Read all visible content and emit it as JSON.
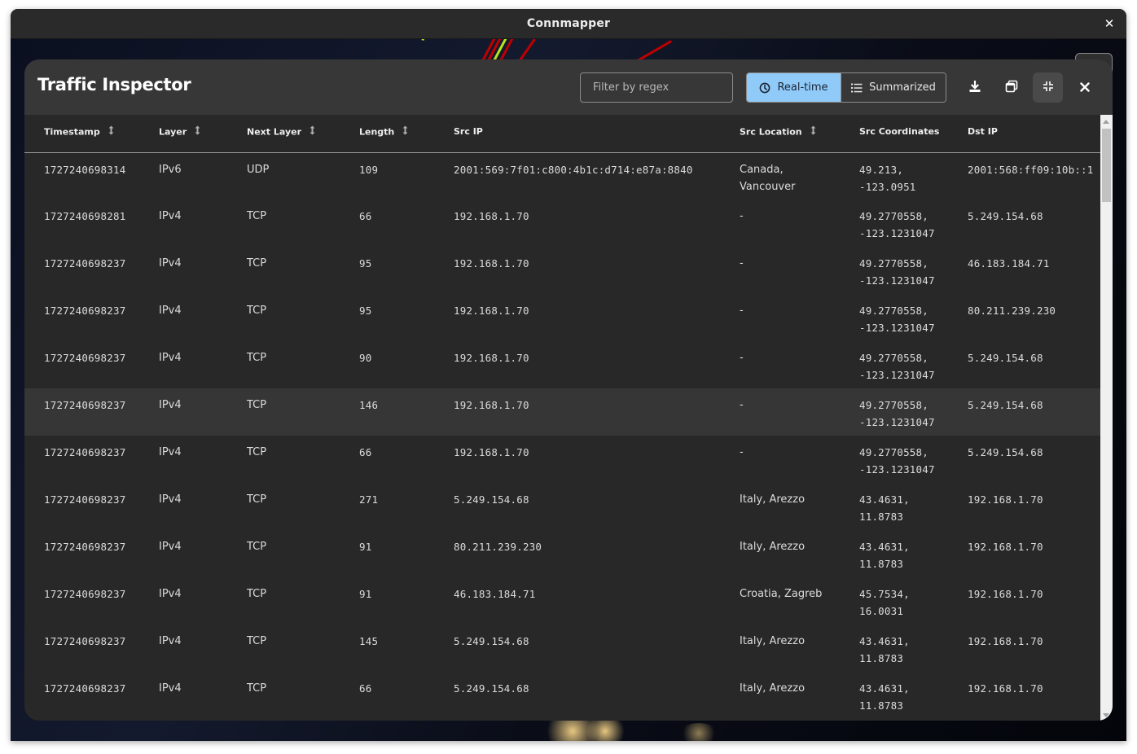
{
  "window": {
    "title": "Connmapper",
    "close_icon": "close-icon"
  },
  "dialog": {
    "title": "Traffic Inspector",
    "filter": {
      "placeholder": "Filter by regex",
      "value": ""
    },
    "view_toggle": {
      "options": [
        {
          "label": "Real-time",
          "icon": "clock-icon",
          "active": true
        },
        {
          "label": "Summarized",
          "icon": "list-icon",
          "active": false
        }
      ]
    },
    "actions": [
      {
        "name": "download",
        "icon": "download-icon"
      },
      {
        "name": "detach-window",
        "icon": "window-restore-icon"
      },
      {
        "name": "exit-fullscreen",
        "icon": "collapse-icon",
        "active": true
      },
      {
        "name": "close",
        "icon": "close-icon"
      }
    ]
  },
  "colors": {
    "accent": "#90caf9",
    "dialog_bg": "#282828",
    "header_bg": "#373737",
    "row_highlight": "#363636",
    "map_line_green": "#b5e61d",
    "map_line_red": "#c00000"
  },
  "table": {
    "columns": [
      {
        "label": "Timestamp",
        "sortable": true
      },
      {
        "label": "Layer",
        "sortable": true
      },
      {
        "label": "Next Layer",
        "sortable": true
      },
      {
        "label": "Length",
        "sortable": true
      },
      {
        "label": "Src IP",
        "sortable": false
      },
      {
        "label": "Src Location",
        "sortable": true
      },
      {
        "label": "Src Coordinates",
        "sortable": false
      },
      {
        "label": "Dst IP",
        "sortable": false
      }
    ],
    "rows": [
      {
        "timestamp": "1727240698314",
        "layer": "IPv6",
        "next_layer": "UDP",
        "length": "109",
        "src_ip": "2001:569:7f01:c800:4b1c:d714:e87a:8840",
        "src_location": "Canada, Vancouver",
        "src_coordinates": "49.213, -123.0951",
        "dst_ip": "2001:568:ff09:10b::1"
      },
      {
        "timestamp": "1727240698281",
        "layer": "IPv4",
        "next_layer": "TCP",
        "length": "66",
        "src_ip": "192.168.1.70",
        "src_location": "-",
        "src_coordinates": "49.2770558, -123.1231047",
        "dst_ip": "5.249.154.68"
      },
      {
        "timestamp": "1727240698237",
        "layer": "IPv4",
        "next_layer": "TCP",
        "length": "95",
        "src_ip": "192.168.1.70",
        "src_location": "-",
        "src_coordinates": "49.2770558, -123.1231047",
        "dst_ip": "46.183.184.71"
      },
      {
        "timestamp": "1727240698237",
        "layer": "IPv4",
        "next_layer": "TCP",
        "length": "95",
        "src_ip": "192.168.1.70",
        "src_location": "-",
        "src_coordinates": "49.2770558, -123.1231047",
        "dst_ip": "80.211.239.230"
      },
      {
        "timestamp": "1727240698237",
        "layer": "IPv4",
        "next_layer": "TCP",
        "length": "90",
        "src_ip": "192.168.1.70",
        "src_location": "-",
        "src_coordinates": "49.2770558, -123.1231047",
        "dst_ip": "5.249.154.68"
      },
      {
        "timestamp": "1727240698237",
        "layer": "IPv4",
        "next_layer": "TCP",
        "length": "146",
        "src_ip": "192.168.1.70",
        "src_location": "-",
        "src_coordinates": "49.2770558, -123.1231047",
        "dst_ip": "5.249.154.68",
        "highlighted": true
      },
      {
        "timestamp": "1727240698237",
        "layer": "IPv4",
        "next_layer": "TCP",
        "length": "66",
        "src_ip": "192.168.1.70",
        "src_location": "-",
        "src_coordinates": "49.2770558, -123.1231047",
        "dst_ip": "5.249.154.68"
      },
      {
        "timestamp": "1727240698237",
        "layer": "IPv4",
        "next_layer": "TCP",
        "length": "271",
        "src_ip": "5.249.154.68",
        "src_location": "Italy, Arezzo",
        "src_coordinates": "43.4631, 11.8783",
        "dst_ip": "192.168.1.70"
      },
      {
        "timestamp": "1727240698237",
        "layer": "IPv4",
        "next_layer": "TCP",
        "length": "91",
        "src_ip": "80.211.239.230",
        "src_location": "Italy, Arezzo",
        "src_coordinates": "43.4631, 11.8783",
        "dst_ip": "192.168.1.70"
      },
      {
        "timestamp": "1727240698237",
        "layer": "IPv4",
        "next_layer": "TCP",
        "length": "91",
        "src_ip": "46.183.184.71",
        "src_location": "Croatia, Zagreb",
        "src_coordinates": "45.7534, 16.0031",
        "dst_ip": "192.168.1.70"
      },
      {
        "timestamp": "1727240698237",
        "layer": "IPv4",
        "next_layer": "TCP",
        "length": "145",
        "src_ip": "5.249.154.68",
        "src_location": "Italy, Arezzo",
        "src_coordinates": "43.4631, 11.8783",
        "dst_ip": "192.168.1.70"
      },
      {
        "timestamp": "1727240698237",
        "layer": "IPv4",
        "next_layer": "TCP",
        "length": "66",
        "src_ip": "5.249.154.68",
        "src_location": "Italy, Arezzo",
        "src_coordinates": "43.4631, 11.8783",
        "dst_ip": "192.168.1.70"
      }
    ]
  }
}
